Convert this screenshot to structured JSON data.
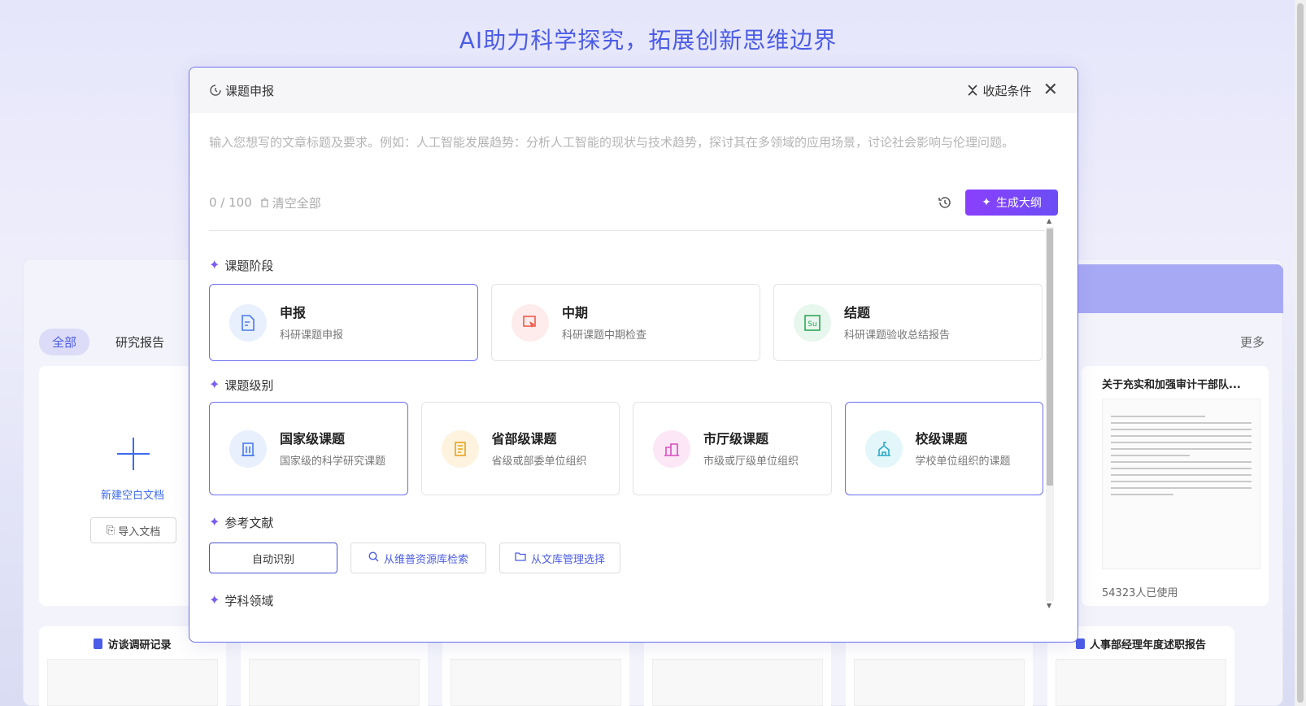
{
  "page": {
    "hero_title": "AI助力科学探究，拓展创新思维边界",
    "tabs": [
      "全部",
      "研究报告"
    ],
    "more": "更多",
    "new_doc": {
      "label": "新建空白文档",
      "import_label": "导入文档"
    },
    "template_right": {
      "title": "关于充实和加强审计干部队...",
      "uses": "54323人已使用"
    },
    "bottom_cards": [
      "访谈调研记录",
      "",
      "",
      "",
      "",
      "人事部经理年度述职报告"
    ]
  },
  "modal": {
    "title": "课题申报",
    "collapse_label": "收起条件",
    "prompt_placeholder": "输入您想写的文章标题及要求。例如：人工智能发展趋势：分析人工智能的现状与技术趋势，探讨其在多领域的应用场景，讨论社会影响与伦理问题。",
    "counter": "0 / 100",
    "clear_all": "清空全部",
    "generate_label": "生成大纲",
    "sections": {
      "stage": "课题阶段",
      "level": "课题级别",
      "refs": "参考文献",
      "field": "学科领域"
    },
    "stages": [
      {
        "name": "申报",
        "desc": "科研课题申报",
        "icon": "file-icon",
        "selected": true
      },
      {
        "name": "中期",
        "desc": "科研课题中期检查",
        "icon": "cursor-icon",
        "selected": false
      },
      {
        "name": "结题",
        "desc": "科研课题验收总结报告",
        "icon": "su-icon",
        "selected": false
      }
    ],
    "levels": [
      {
        "name": "国家级课题",
        "desc": "国家级的科学研究课题",
        "icon": "building-icon",
        "selected": true
      },
      {
        "name": "省部级课题",
        "desc": "省级或部委单位组织",
        "icon": "tablet-icon",
        "selected": false
      },
      {
        "name": "市厅级课题",
        "desc": "市级或厅级单位组织",
        "icon": "office-icon",
        "selected": false
      },
      {
        "name": "校级课题",
        "desc": "学校单位组织的课题",
        "icon": "school-icon",
        "selected": true
      }
    ],
    "refs": [
      {
        "label": "自动识别",
        "selected": true
      },
      {
        "label": "从维普资源库检索",
        "selected": false
      },
      {
        "label": "从文库管理选择",
        "selected": false
      }
    ]
  },
  "colors": {
    "accent": "#4b5ce6",
    "selected_border": "#6b6ff0",
    "generate_btn": "#7b45f8"
  }
}
